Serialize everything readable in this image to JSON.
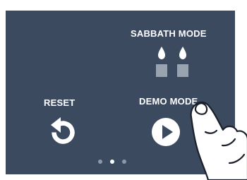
{
  "colors": {
    "panel": "#3b4a5f",
    "text": "#ffffff",
    "candle_body": "#9aa3b0",
    "dot_inactive": "#8e98a8",
    "dot_active": "#ffffff"
  },
  "sabbath": {
    "label": "SABBATH MODE",
    "icon": "candles-icon"
  },
  "reset": {
    "label": "RESET",
    "icon": "reset-arrow-icon"
  },
  "demo": {
    "label": "DEMO MODE",
    "icon": "play-icon"
  },
  "pagination": {
    "total": 3,
    "active_index": 1
  },
  "overlay": {
    "icon": "pointing-hand-icon"
  }
}
